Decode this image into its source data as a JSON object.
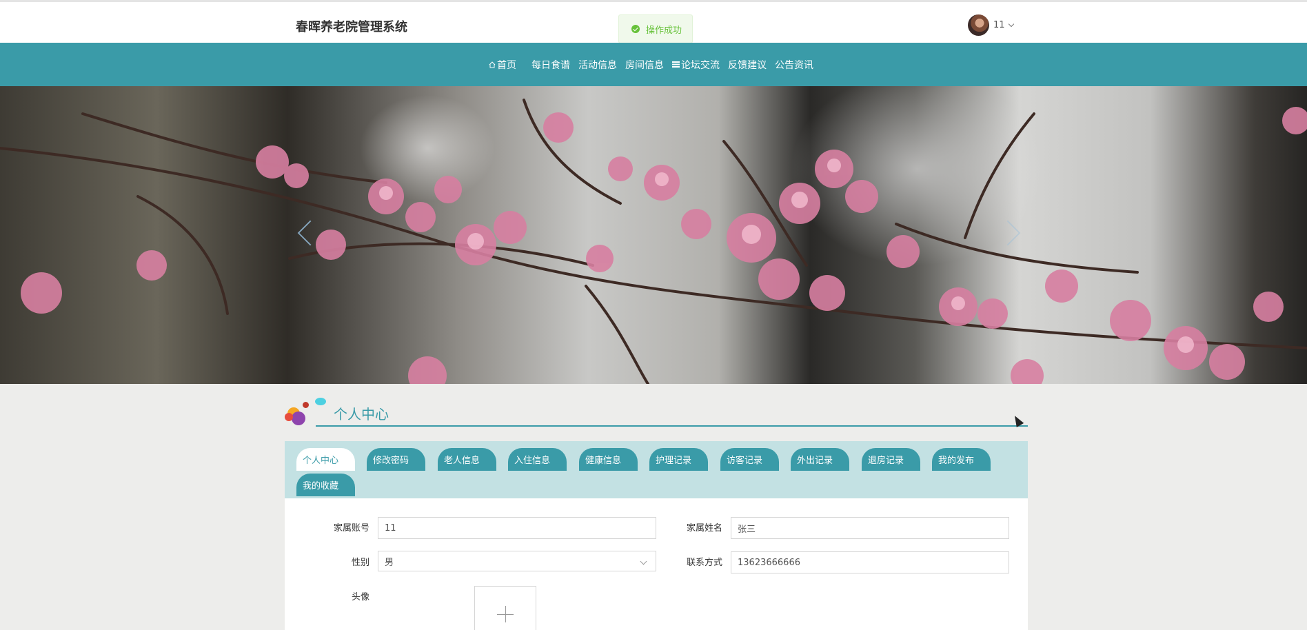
{
  "header": {
    "brand": "春晖养老院管理系统",
    "toast": "操作成功",
    "user_name": "11"
  },
  "nav": {
    "items": [
      {
        "label": "首页",
        "icon": "home-icon"
      },
      {
        "label": "每日食谱"
      },
      {
        "label": "活动信息"
      },
      {
        "label": "房间信息"
      },
      {
        "label": "论坛交流",
        "icon": "forum-icon"
      },
      {
        "label": "反馈建议"
      },
      {
        "label": "公告资讯"
      }
    ]
  },
  "banner": {
    "prev_icon": "chevron-left-icon",
    "next_icon": "chevron-right-icon"
  },
  "section": {
    "title": "个人中心"
  },
  "tabs": [
    {
      "label": "个人中心",
      "active": true
    },
    {
      "label": "修改密码"
    },
    {
      "label": "老人信息"
    },
    {
      "label": "入住信息"
    },
    {
      "label": "健康信息"
    },
    {
      "label": "护理记录"
    },
    {
      "label": "访客记录"
    },
    {
      "label": "外出记录"
    },
    {
      "label": "退房记录"
    },
    {
      "label": "我的发布"
    },
    {
      "label": "我的收藏"
    }
  ],
  "form": {
    "account_label": "家属账号",
    "account_value": "11",
    "name_label": "家属姓名",
    "name_value": "张三",
    "gender_label": "性别",
    "gender_value": "男",
    "phone_label": "联系方式",
    "phone_value": "13623666666",
    "avatar_label": "头像"
  },
  "colors": {
    "accent": "#3a9ba8",
    "tabs_bg": "#c3e1e3",
    "success": "#67c23a"
  }
}
